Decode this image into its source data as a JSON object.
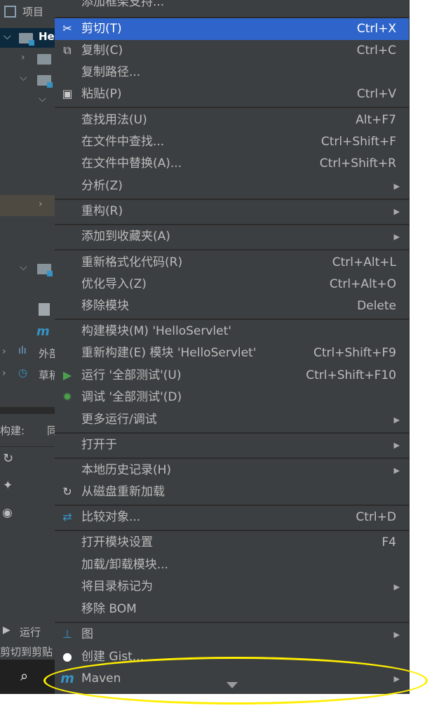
{
  "left_panel": {
    "project_label": "项目",
    "root_label": "He",
    "external_label": "外部",
    "scratch_label": "草稿",
    "build_label": "构建:",
    "sync_label": "同",
    "run_label": "运行",
    "status_text": "剪切到剪贴"
  },
  "menu": {
    "top_partial": "添加框架支持...",
    "items": [
      {
        "label": "剪切(T)",
        "shortcut": "Ctrl+X"
      },
      {
        "label": "复制(C)",
        "shortcut": "Ctrl+C"
      },
      {
        "label": "复制路径...",
        "shortcut": ""
      },
      {
        "label": "粘贴(P)",
        "shortcut": "Ctrl+V"
      },
      {
        "label": "查找用法(U)",
        "shortcut": "Alt+F7"
      },
      {
        "label": "在文件中查找...",
        "shortcut": "Ctrl+Shift+F"
      },
      {
        "label": "在文件中替换(A)...",
        "shortcut": "Ctrl+Shift+R"
      },
      {
        "label": "分析(Z)",
        "shortcut": ""
      },
      {
        "label": "重构(R)",
        "shortcut": ""
      },
      {
        "label": "添加到收藏夹(A)",
        "shortcut": ""
      },
      {
        "label": "重新格式化代码(R)",
        "shortcut": "Ctrl+Alt+L"
      },
      {
        "label": "优化导入(Z)",
        "shortcut": "Ctrl+Alt+O"
      },
      {
        "label": "移除模块",
        "shortcut": "Delete"
      },
      {
        "label": "构建模块(M) 'HelloServlet'",
        "shortcut": ""
      },
      {
        "label": "重新构建(E) 模块 'HelloServlet'",
        "shortcut": "Ctrl+Shift+F9"
      },
      {
        "label": "运行 '全部测试'(U)",
        "shortcut": "Ctrl+Shift+F10"
      },
      {
        "label": "调试 '全部测试'(D)",
        "shortcut": ""
      },
      {
        "label": "更多运行/调试",
        "shortcut": ""
      },
      {
        "label": "打开于",
        "shortcut": ""
      },
      {
        "label": "本地历史记录(H)",
        "shortcut": ""
      },
      {
        "label": "从磁盘重新加载",
        "shortcut": ""
      },
      {
        "label": "比较对象...",
        "shortcut": "Ctrl+D"
      },
      {
        "label": "打开模块设置",
        "shortcut": "F4"
      },
      {
        "label": "加载/卸载模块...",
        "shortcut": ""
      },
      {
        "label": "将目录标记为",
        "shortcut": ""
      },
      {
        "label": "移除 BOM",
        "shortcut": ""
      },
      {
        "label": "图",
        "shortcut": ""
      },
      {
        "label": "创建 Gist...",
        "shortcut": ""
      },
      {
        "label": "Maven",
        "shortcut": ""
      }
    ]
  },
  "colors": {
    "menu_bg": "#3c3f41",
    "selection": "#2f65ca",
    "annotation": "#ffee00"
  }
}
